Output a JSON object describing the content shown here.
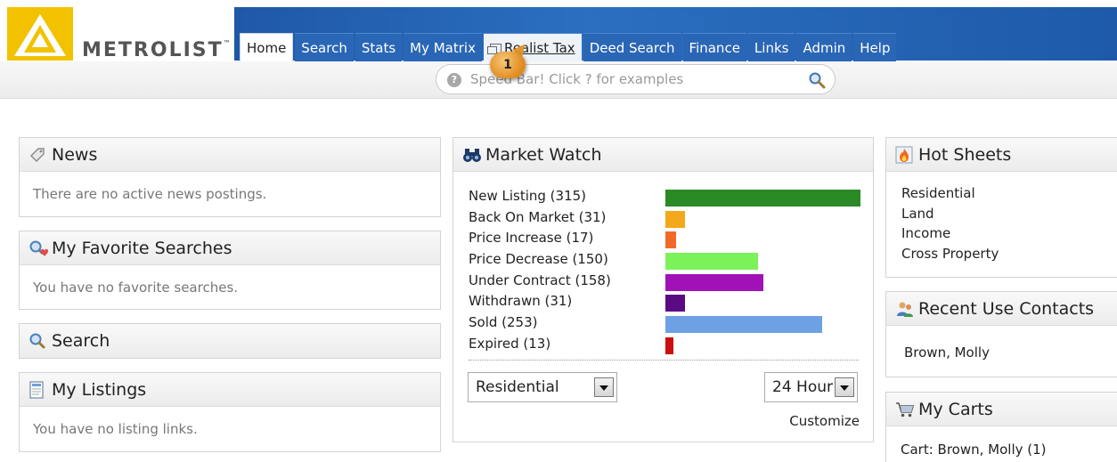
{
  "brand": {
    "name": "METROLIST",
    "tm": "™"
  },
  "nav": {
    "tabs": [
      {
        "label": "Home",
        "state": "active"
      },
      {
        "label": "Search",
        "state": "normal"
      },
      {
        "label": "Stats",
        "state": "normal"
      },
      {
        "label": "My Matrix",
        "state": "normal"
      },
      {
        "label": "Realist Tax",
        "state": "hover"
      },
      {
        "label": "Deed Search",
        "state": "normal"
      },
      {
        "label": "Finance",
        "state": "normal"
      },
      {
        "label": "Links",
        "state": "normal"
      },
      {
        "label": "Admin",
        "state": "normal"
      },
      {
        "label": "Help",
        "state": "normal"
      }
    ]
  },
  "speedbar": {
    "placeholder": "Speed Bar! Click ? for examples",
    "help_glyph": "?"
  },
  "callout": {
    "number": "1"
  },
  "news": {
    "title": "News",
    "empty_text": "There are no active news postings."
  },
  "favorites": {
    "title": "My Favorite Searches",
    "empty_text": "You have no favorite searches."
  },
  "search_panel": {
    "title": "Search"
  },
  "listings": {
    "title": "My Listings",
    "empty_text": "You have no listing links."
  },
  "market_watch": {
    "title": "Market Watch",
    "rows": [
      {
        "label": "New Listing (315)",
        "value": 315,
        "color": "#2a8a26"
      },
      {
        "label": "Back On Market (31)",
        "value": 31,
        "color": "#f4a81c"
      },
      {
        "label": "Price Increase (17)",
        "value": 17,
        "color": "#f26a2a"
      },
      {
        "label": "Price Decrease (150)",
        "value": 150,
        "color": "#7cf25a"
      },
      {
        "label": "Under Contract (158)",
        "value": 158,
        "color": "#a012b8"
      },
      {
        "label": "Withdrawn (31)",
        "value": 31,
        "color": "#5a0a82"
      },
      {
        "label": "Sold (253)",
        "value": 253,
        "color": "#6ea0e4"
      },
      {
        "label": "Expired (13)",
        "value": 13,
        "color": "#cc1010"
      }
    ],
    "property_type": "Residential",
    "time_window": "24 Hour",
    "customize_label": "Customize"
  },
  "hot_sheets": {
    "title": "Hot Sheets",
    "items": [
      "Residential",
      "Land",
      "Income",
      "Cross Property"
    ]
  },
  "recent_contacts": {
    "title": "Recent Use Contacts",
    "items": [
      "Brown, Molly"
    ]
  },
  "carts": {
    "title": "My Carts",
    "items": [
      "Cart: Brown, Molly (1)"
    ]
  }
}
